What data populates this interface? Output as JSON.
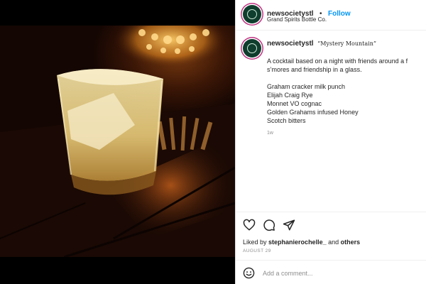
{
  "post": {
    "username": "newsocietystl",
    "follow_label": "Follow",
    "location": "Grand Spirits Bottle Co."
  },
  "caption": {
    "username": "newsocietystl",
    "title": "“Mystery Mountain”",
    "line1": "A cocktail based on a night with friends around a f",
    "line2": "s’mores and friendship in a glass.",
    "ingredients": [
      "Graham cracker milk punch",
      "Elijah Craig Rye",
      "Monnet VO cognac",
      "Golden Grahams infused Honey",
      "Scotch bitters"
    ],
    "time": "1w"
  },
  "likes": {
    "prefix": "Liked by",
    "user": "stephanierochelle_",
    "connector": "and",
    "others": "others",
    "date": "AUGUST 29"
  },
  "comment": {
    "placeholder": "Add a comment..."
  },
  "icons": {
    "like": "heart-icon",
    "comment": "comment-bubble-icon",
    "share": "paper-plane-icon",
    "emoji": "smiley-icon"
  },
  "colors": {
    "accent": "#0095f6",
    "text": "#262626",
    "muted": "#8e8e8e"
  }
}
